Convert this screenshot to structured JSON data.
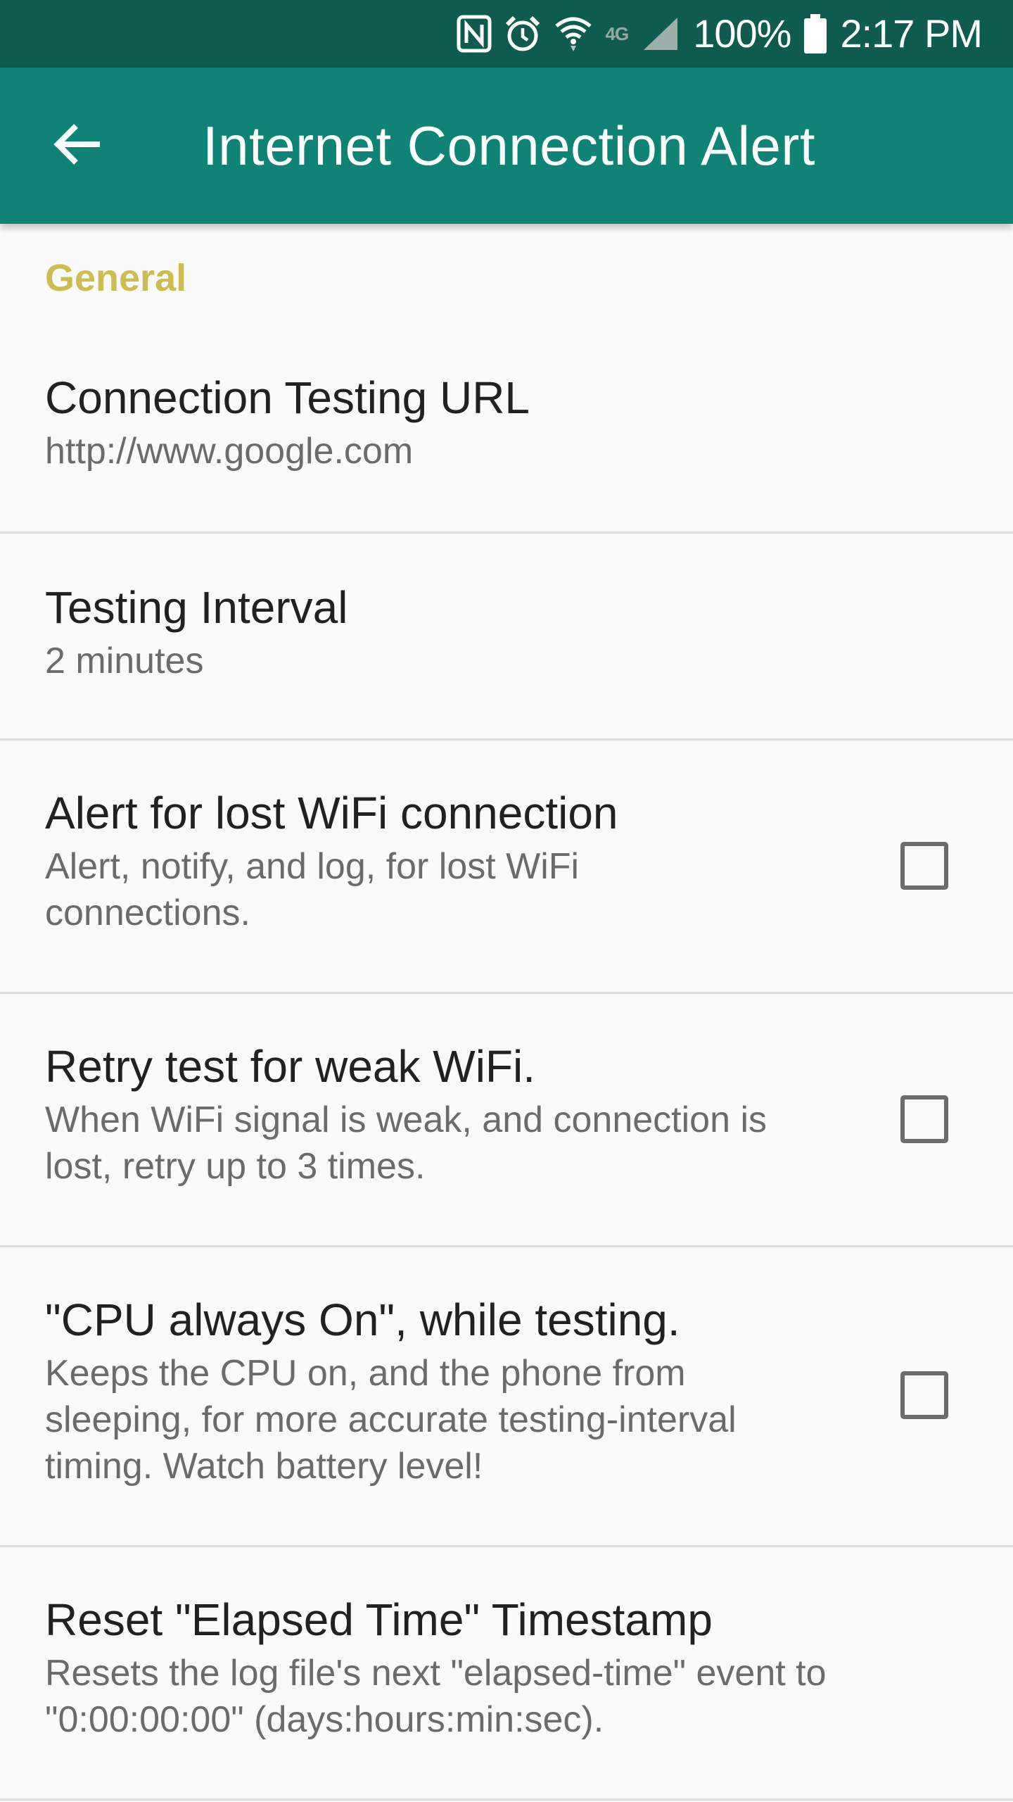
{
  "status_bar": {
    "battery_percent": "100%",
    "time": "2:17 PM",
    "network_label": "4G",
    "icons": [
      "nfc-icon",
      "alarm-icon",
      "wifi-icon",
      "4g-icon",
      "signal-icon",
      "battery-icon"
    ]
  },
  "app_bar": {
    "back_icon": "arrow-left-icon",
    "title": "Internet Connection Alert"
  },
  "colors": {
    "status_bar_bg": "#0f5b50",
    "app_bar_bg": "#0f8376",
    "section_header": "#cbbd52"
  },
  "settings": {
    "section_title": "General",
    "items": [
      {
        "title": "Connection Testing URL",
        "summary": "http://www.google.com",
        "has_checkbox": false
      },
      {
        "title": "Testing Interval",
        "summary": "2 minutes",
        "has_checkbox": false
      },
      {
        "title": "Alert for lost WiFi connection",
        "summary": "Alert, notify, and log, for lost WiFi connections.",
        "has_checkbox": true,
        "checked": false
      },
      {
        "title": "Retry test for weak WiFi.",
        "summary": "When WiFi signal is weak, and connection is lost, retry up to 3 times.",
        "has_checkbox": true,
        "checked": false
      },
      {
        "title": "\"CPU always On\", while testing.",
        "summary": "Keeps the CPU on, and the phone from sleeping, for more accurate testing-interval timing. Watch battery level!",
        "has_checkbox": true,
        "checked": false
      },
      {
        "title": "Reset \"Elapsed Time\" Timestamp",
        "summary": "Resets the log file's next \"elapsed-time\" event to \"0:00:00:00\" (days:hours:min:sec).",
        "has_checkbox": false
      }
    ]
  }
}
